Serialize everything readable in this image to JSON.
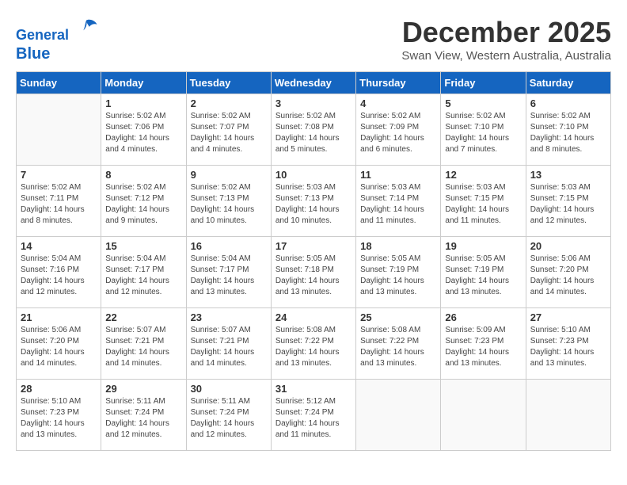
{
  "header": {
    "logo_line1": "General",
    "logo_line2": "Blue",
    "month": "December 2025",
    "location": "Swan View, Western Australia, Australia"
  },
  "days_of_week": [
    "Sunday",
    "Monday",
    "Tuesday",
    "Wednesday",
    "Thursday",
    "Friday",
    "Saturday"
  ],
  "weeks": [
    [
      {
        "day": "",
        "sunrise": "",
        "sunset": "",
        "daylight": ""
      },
      {
        "day": "1",
        "sunrise": "Sunrise: 5:02 AM",
        "sunset": "Sunset: 7:06 PM",
        "daylight": "Daylight: 14 hours and 4 minutes."
      },
      {
        "day": "2",
        "sunrise": "Sunrise: 5:02 AM",
        "sunset": "Sunset: 7:07 PM",
        "daylight": "Daylight: 14 hours and 4 minutes."
      },
      {
        "day": "3",
        "sunrise": "Sunrise: 5:02 AM",
        "sunset": "Sunset: 7:08 PM",
        "daylight": "Daylight: 14 hours and 5 minutes."
      },
      {
        "day": "4",
        "sunrise": "Sunrise: 5:02 AM",
        "sunset": "Sunset: 7:09 PM",
        "daylight": "Daylight: 14 hours and 6 minutes."
      },
      {
        "day": "5",
        "sunrise": "Sunrise: 5:02 AM",
        "sunset": "Sunset: 7:10 PM",
        "daylight": "Daylight: 14 hours and 7 minutes."
      },
      {
        "day": "6",
        "sunrise": "Sunrise: 5:02 AM",
        "sunset": "Sunset: 7:10 PM",
        "daylight": "Daylight: 14 hours and 8 minutes."
      }
    ],
    [
      {
        "day": "7",
        "sunrise": "Sunrise: 5:02 AM",
        "sunset": "Sunset: 7:11 PM",
        "daylight": "Daylight: 14 hours and 8 minutes."
      },
      {
        "day": "8",
        "sunrise": "Sunrise: 5:02 AM",
        "sunset": "Sunset: 7:12 PM",
        "daylight": "Daylight: 14 hours and 9 minutes."
      },
      {
        "day": "9",
        "sunrise": "Sunrise: 5:02 AM",
        "sunset": "Sunset: 7:13 PM",
        "daylight": "Daylight: 14 hours and 10 minutes."
      },
      {
        "day": "10",
        "sunrise": "Sunrise: 5:03 AM",
        "sunset": "Sunset: 7:13 PM",
        "daylight": "Daylight: 14 hours and 10 minutes."
      },
      {
        "day": "11",
        "sunrise": "Sunrise: 5:03 AM",
        "sunset": "Sunset: 7:14 PM",
        "daylight": "Daylight: 14 hours and 11 minutes."
      },
      {
        "day": "12",
        "sunrise": "Sunrise: 5:03 AM",
        "sunset": "Sunset: 7:15 PM",
        "daylight": "Daylight: 14 hours and 11 minutes."
      },
      {
        "day": "13",
        "sunrise": "Sunrise: 5:03 AM",
        "sunset": "Sunset: 7:15 PM",
        "daylight": "Daylight: 14 hours and 12 minutes."
      }
    ],
    [
      {
        "day": "14",
        "sunrise": "Sunrise: 5:04 AM",
        "sunset": "Sunset: 7:16 PM",
        "daylight": "Daylight: 14 hours and 12 minutes."
      },
      {
        "day": "15",
        "sunrise": "Sunrise: 5:04 AM",
        "sunset": "Sunset: 7:17 PM",
        "daylight": "Daylight: 14 hours and 12 minutes."
      },
      {
        "day": "16",
        "sunrise": "Sunrise: 5:04 AM",
        "sunset": "Sunset: 7:17 PM",
        "daylight": "Daylight: 14 hours and 13 minutes."
      },
      {
        "day": "17",
        "sunrise": "Sunrise: 5:05 AM",
        "sunset": "Sunset: 7:18 PM",
        "daylight": "Daylight: 14 hours and 13 minutes."
      },
      {
        "day": "18",
        "sunrise": "Sunrise: 5:05 AM",
        "sunset": "Sunset: 7:19 PM",
        "daylight": "Daylight: 14 hours and 13 minutes."
      },
      {
        "day": "19",
        "sunrise": "Sunrise: 5:05 AM",
        "sunset": "Sunset: 7:19 PM",
        "daylight": "Daylight: 14 hours and 13 minutes."
      },
      {
        "day": "20",
        "sunrise": "Sunrise: 5:06 AM",
        "sunset": "Sunset: 7:20 PM",
        "daylight": "Daylight: 14 hours and 14 minutes."
      }
    ],
    [
      {
        "day": "21",
        "sunrise": "Sunrise: 5:06 AM",
        "sunset": "Sunset: 7:20 PM",
        "daylight": "Daylight: 14 hours and 14 minutes."
      },
      {
        "day": "22",
        "sunrise": "Sunrise: 5:07 AM",
        "sunset": "Sunset: 7:21 PM",
        "daylight": "Daylight: 14 hours and 14 minutes."
      },
      {
        "day": "23",
        "sunrise": "Sunrise: 5:07 AM",
        "sunset": "Sunset: 7:21 PM",
        "daylight": "Daylight: 14 hours and 14 minutes."
      },
      {
        "day": "24",
        "sunrise": "Sunrise: 5:08 AM",
        "sunset": "Sunset: 7:22 PM",
        "daylight": "Daylight: 14 hours and 13 minutes."
      },
      {
        "day": "25",
        "sunrise": "Sunrise: 5:08 AM",
        "sunset": "Sunset: 7:22 PM",
        "daylight": "Daylight: 14 hours and 13 minutes."
      },
      {
        "day": "26",
        "sunrise": "Sunrise: 5:09 AM",
        "sunset": "Sunset: 7:23 PM",
        "daylight": "Daylight: 14 hours and 13 minutes."
      },
      {
        "day": "27",
        "sunrise": "Sunrise: 5:10 AM",
        "sunset": "Sunset: 7:23 PM",
        "daylight": "Daylight: 14 hours and 13 minutes."
      }
    ],
    [
      {
        "day": "28",
        "sunrise": "Sunrise: 5:10 AM",
        "sunset": "Sunset: 7:23 PM",
        "daylight": "Daylight: 14 hours and 13 minutes."
      },
      {
        "day": "29",
        "sunrise": "Sunrise: 5:11 AM",
        "sunset": "Sunset: 7:24 PM",
        "daylight": "Daylight: 14 hours and 12 minutes."
      },
      {
        "day": "30",
        "sunrise": "Sunrise: 5:11 AM",
        "sunset": "Sunset: 7:24 PM",
        "daylight": "Daylight: 14 hours and 12 minutes."
      },
      {
        "day": "31",
        "sunrise": "Sunrise: 5:12 AM",
        "sunset": "Sunset: 7:24 PM",
        "daylight": "Daylight: 14 hours and 11 minutes."
      },
      {
        "day": "",
        "sunrise": "",
        "sunset": "",
        "daylight": ""
      },
      {
        "day": "",
        "sunrise": "",
        "sunset": "",
        "daylight": ""
      },
      {
        "day": "",
        "sunrise": "",
        "sunset": "",
        "daylight": ""
      }
    ]
  ]
}
